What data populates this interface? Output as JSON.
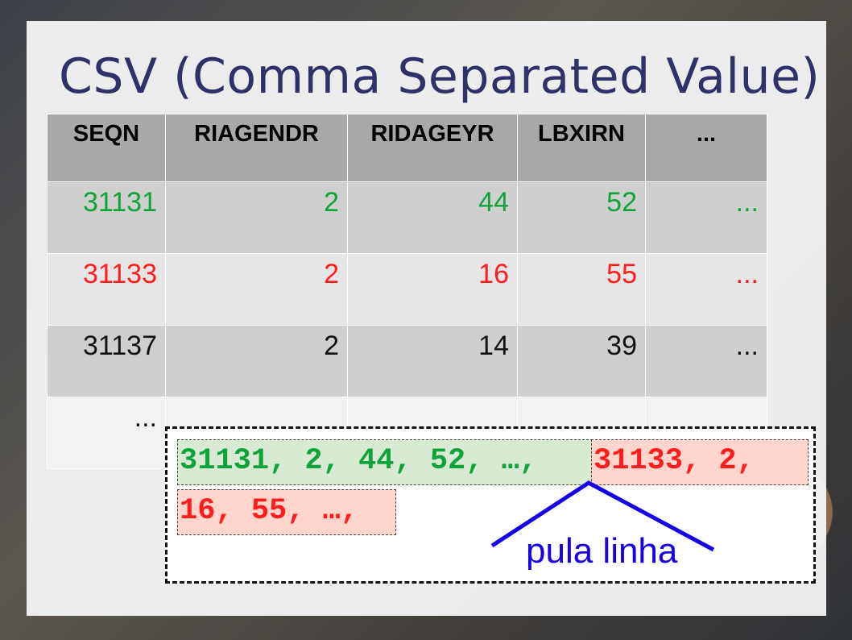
{
  "slide": {
    "title": "CSV (Comma Separated Value)"
  },
  "table": {
    "headers": [
      "SEQN",
      "RIAGENDR",
      "RIDAGEYR",
      "LBXIRN",
      "..."
    ],
    "rows": [
      {
        "color": "green",
        "cells": [
          "31131",
          "2",
          "44",
          "52",
          "..."
        ]
      },
      {
        "color": "red",
        "cells": [
          "31133",
          "2",
          "16",
          "55",
          "..."
        ]
      },
      {
        "color": "black",
        "cells": [
          "31137",
          "2",
          "14",
          "39",
          "..."
        ]
      },
      {
        "color": "black",
        "cells": [
          "...",
          "",
          "",
          "",
          ""
        ]
      }
    ]
  },
  "csv": {
    "line1_green": "31131, 2, 44, 52, …,",
    "line1_red": " 31133, 2,",
    "line2_red": "16, 55, …,",
    "annotation": "pula linha"
  },
  "colors": {
    "title": "#2f3268",
    "green": "#10a33a",
    "red": "#ff1c1c",
    "annotation": "#1500e8",
    "header_bg": "#a8a8a8"
  }
}
